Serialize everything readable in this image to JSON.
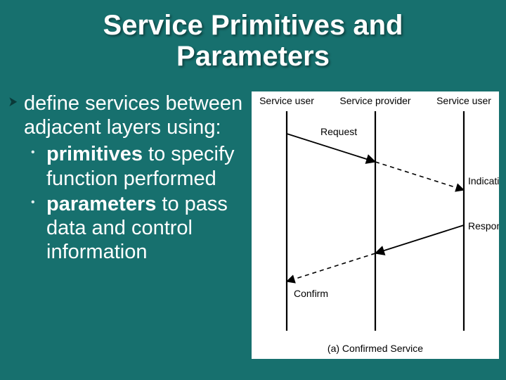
{
  "title_line1": "Service Primitives and",
  "title_line2": "Parameters",
  "bullets": {
    "level1": "define services between adjacent layers using:",
    "sub1_bold": "primitives",
    "sub1_rest": " to specify function performed",
    "sub2_bold": "parameters",
    "sub2_rest": " to pass data and control information"
  },
  "diagram": {
    "actors": {
      "left": "Service user",
      "center": "Service provider",
      "right": "Service user"
    },
    "messages": {
      "request": "Request",
      "indication": "Indication",
      "response": "Response",
      "confirm": "Confirm"
    },
    "caption": "(a) Confirmed Service"
  },
  "chart_data": {
    "type": "sequence-diagram",
    "participants": [
      "Service user (left)",
      "Service provider",
      "Service user (right)"
    ],
    "messages": [
      {
        "from": "Service user (left)",
        "to": "Service provider",
        "label": "Request",
        "style": "solid"
      },
      {
        "from": "Service provider",
        "to": "Service user (right)",
        "label": "Indication",
        "style": "dashed"
      },
      {
        "from": "Service user (right)",
        "to": "Service provider",
        "label": "Response",
        "style": "solid"
      },
      {
        "from": "Service provider",
        "to": "Service user (left)",
        "label": "Confirm",
        "style": "dashed"
      }
    ],
    "caption": "(a) Confirmed Service"
  }
}
